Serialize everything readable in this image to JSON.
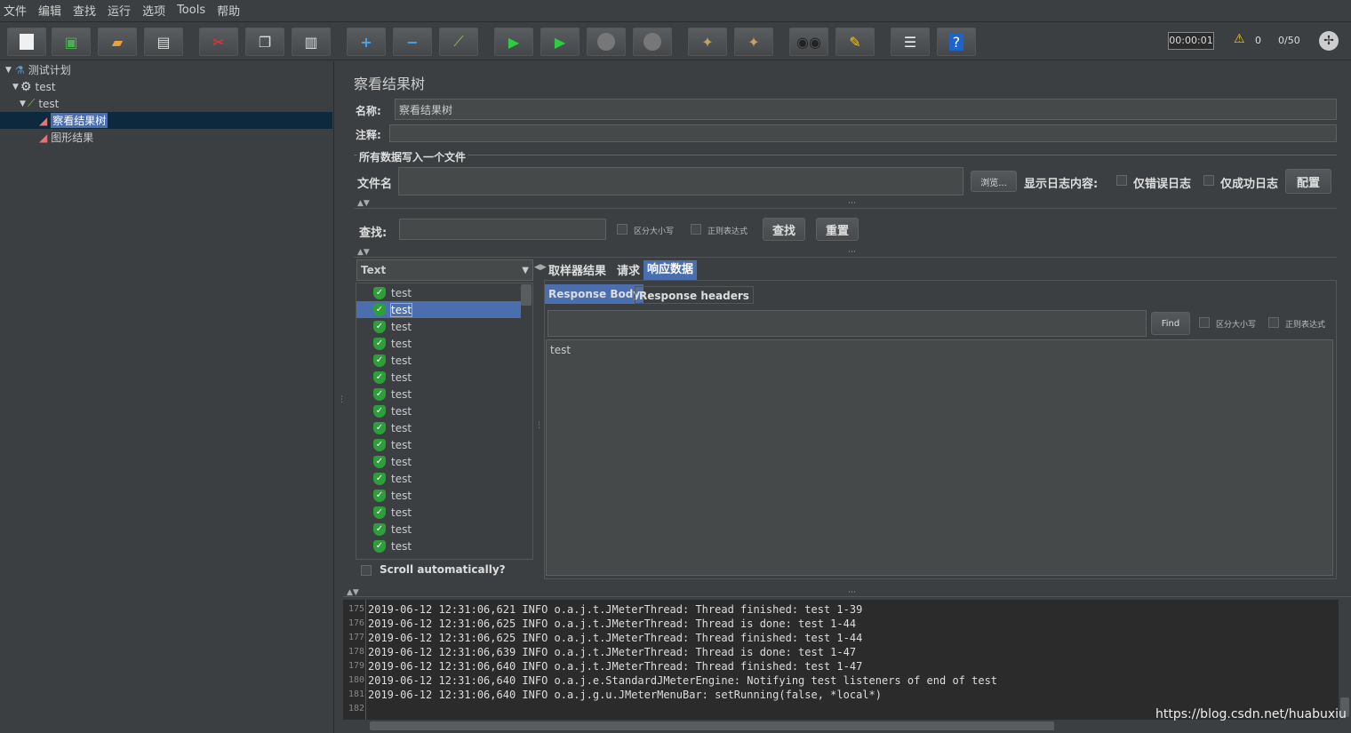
{
  "menu": [
    "文件",
    "编辑",
    "查找",
    "运行",
    "选项",
    "Tools",
    "帮助"
  ],
  "toolbar": {
    "icons": [
      "new-icon",
      "templates-icon",
      "open-icon",
      "save-icon",
      "cut-icon",
      "copy-icon",
      "paste-icon",
      "expand-icon",
      "collapse-icon",
      "toggle-icon",
      "start-icon",
      "start-no-pause-icon",
      "stop-icon",
      "shutdown-icon",
      "clear-icon",
      "clear-all-icon",
      "search-icon",
      "reset-search-icon",
      "function-helper-icon",
      "help-icon"
    ],
    "timer": "00:00:01",
    "warning_count": "0",
    "threads": "0/50"
  },
  "tree": [
    {
      "label": "测试计划"
    },
    {
      "label": "test"
    },
    {
      "label": "test"
    },
    {
      "label": "察看结果树"
    },
    {
      "label": "图形结果"
    }
  ],
  "panel": {
    "title": "察看结果树",
    "name_label": "名称:",
    "name_value": "察看结果树",
    "comment_label": "注释:",
    "group_label": "所有数据写入一个文件",
    "file_label": "文件名",
    "browse": "浏览...",
    "log_label": "显示日志内容:",
    "errors_only": "仅错误日志",
    "success_only": "仅成功日志",
    "configure": "配置",
    "search_label": "查找:",
    "case_sensitive": "区分大小写",
    "regex": "正则表达式",
    "search_btn": "查找",
    "reset_btn": "重置",
    "renderer": "Text",
    "tabs": [
      "取样器结果",
      "请求",
      "响应数据"
    ],
    "subtabs": [
      "Response Body",
      "Response headers"
    ],
    "find_btn": "Find",
    "case_sensitive2": "区分大小写",
    "regex2": "正则表达式",
    "response_text": "test",
    "scroll_auto": "Scroll automatically?"
  },
  "samples": [
    "test",
    "test",
    "test",
    "test",
    "test",
    "test",
    "test",
    "test",
    "test",
    "test",
    "test",
    "test",
    "test",
    "test",
    "test",
    "test"
  ],
  "log": [
    {
      "n": "175",
      "t": "2019-06-12 12:31:06,621 INFO o.a.j.t.JMeterThread: Thread finished: test 1-39"
    },
    {
      "n": "176",
      "t": "2019-06-12 12:31:06,625 INFO o.a.j.t.JMeterThread: Thread is done: test 1-44"
    },
    {
      "n": "177",
      "t": "2019-06-12 12:31:06,625 INFO o.a.j.t.JMeterThread: Thread finished: test 1-44"
    },
    {
      "n": "178",
      "t": "2019-06-12 12:31:06,639 INFO o.a.j.t.JMeterThread: Thread is done: test 1-47"
    },
    {
      "n": "179",
      "t": "2019-06-12 12:31:06,640 INFO o.a.j.t.JMeterThread: Thread finished: test 1-47"
    },
    {
      "n": "180",
      "t": "2019-06-12 12:31:06,640 INFO o.a.j.e.StandardJMeterEngine: Notifying test listeners of end of test"
    },
    {
      "n": "181",
      "t": "2019-06-12 12:31:06,640 INFO o.a.j.g.u.JMeterMenuBar: setRunning(false, *local*)"
    },
    {
      "n": "182",
      "t": ""
    }
  ],
  "watermark": "https://blog.csdn.net/huabuxiu"
}
